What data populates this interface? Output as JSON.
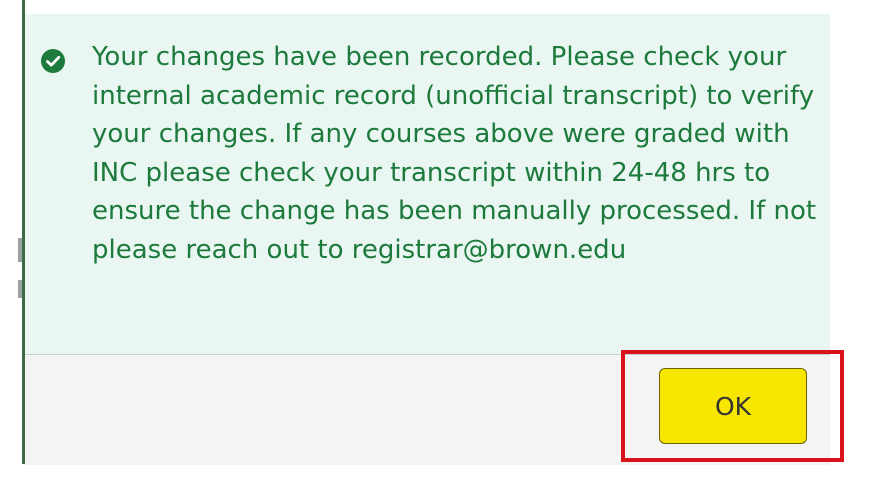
{
  "dialog": {
    "message": "Your changes have been recorded. Please check your internal academic record (unofficial transcript) to verify your changes. If any courses above were graded with INC please check your transcript within 24-48 hrs to ensure the change has been manually processed. If not please reach out to registrar@brown.edu",
    "icon": "check-circle-icon",
    "ok_label": "OK"
  },
  "colors": {
    "message_text": "#1c7a3c",
    "message_background": "#eaf6f1",
    "check_icon": "#1c7a3c",
    "ok_button": "#f6e600",
    "highlight_outline": "#d9121b"
  }
}
